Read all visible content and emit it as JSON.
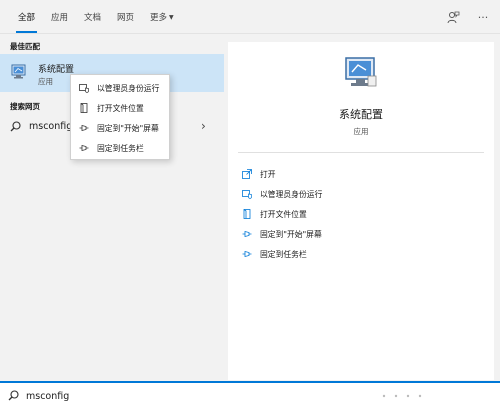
{
  "tabs": [
    {
      "label": "全部"
    },
    {
      "label": "应用"
    },
    {
      "label": "文档"
    },
    {
      "label": "网页"
    },
    {
      "label": "更多"
    }
  ],
  "left": {
    "best_match_label": "最佳匹配",
    "best_item": {
      "title": "系统配置",
      "subtitle": "应用"
    },
    "web_label": "搜索网页",
    "web_query": "msconfig"
  },
  "context_menu": {
    "items": [
      {
        "label": "以管理员身份运行",
        "icon": "admin-icon"
      },
      {
        "label": "打开文件位置",
        "icon": "file-location-icon"
      },
      {
        "label": "固定到\"开始\"屏幕",
        "icon": "pin-icon"
      },
      {
        "label": "固定到任务栏",
        "icon": "pin-icon"
      }
    ]
  },
  "preview": {
    "title": "系统配置",
    "subtitle": "应用",
    "actions": [
      {
        "label": "打开",
        "icon": "open-icon"
      },
      {
        "label": "以管理员身份运行",
        "icon": "admin-icon"
      },
      {
        "label": "打开文件位置",
        "icon": "file-location-icon"
      },
      {
        "label": "固定到\"开始\"屏幕",
        "icon": "pin-icon"
      },
      {
        "label": "固定到任务栏",
        "icon": "pin-icon"
      }
    ]
  },
  "search": {
    "value": "msconfig"
  },
  "colors": {
    "accent": "#0078d7",
    "selection": "#cce4f7"
  }
}
